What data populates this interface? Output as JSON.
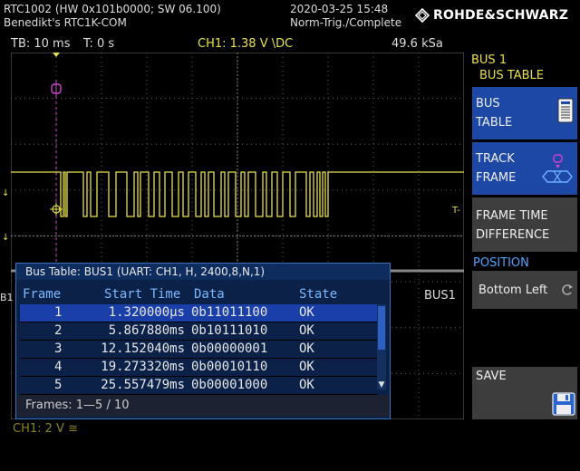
{
  "header": {
    "device_line": "RTC1002 (HW 0x101b0000; SW 06.100)",
    "user_line": "Benedikt's RTC1K-COM",
    "datetime": "2020-03-25 15:48",
    "trigger_status": "Norm-Trig./Complete",
    "brand": "ROHDE&SCHWARZ"
  },
  "status": {
    "timebase": "TB: 10 ms",
    "trigger_time": "T: 0 s",
    "channel": "CH1: 1.38 V \\DC",
    "sample_rate": "49.6 kSa"
  },
  "waveform": {
    "trigger_label": "T",
    "bus_label": "B1",
    "bus_trace_label": "BUS1",
    "marker_right": "T-",
    "ch1_scale": "CH1: 2 V ≅",
    "colors": {
      "trace": "#e8e04a",
      "trigger_marker": "#d040d0",
      "grid": "#5a5a5a"
    }
  },
  "bus_table": {
    "title": "Bus Table: BUS1 (UART: CH1, H, 2400,8,N,1)",
    "columns": [
      "Frame",
      "Start Time",
      "Data",
      "State"
    ],
    "rows": [
      {
        "frame": "1",
        "start": "1.320000µs",
        "data": "0b11011100",
        "state": "OK",
        "selected": true
      },
      {
        "frame": "2",
        "start": "5.867880ms",
        "data": "0b10111010",
        "state": "OK",
        "selected": false
      },
      {
        "frame": "3",
        "start": "12.152040ms",
        "data": "0b00000001",
        "state": "OK",
        "selected": false
      },
      {
        "frame": "4",
        "start": "19.273320ms",
        "data": "0b00010110",
        "state": "OK",
        "selected": false
      },
      {
        "frame": "5",
        "start": "25.557479ms",
        "data": "0b00001000",
        "state": "OK",
        "selected": false
      }
    ],
    "footer": "Frames: 1—5 / 10"
  },
  "menu": {
    "title_line1": "BUS 1",
    "title_line2": "BUS TABLE",
    "softkeys": [
      {
        "line1": "BUS",
        "line2": "TABLE",
        "icon": "table-icon"
      },
      {
        "line1": "TRACK",
        "line2": "FRAME",
        "icon": "track-frame-icon"
      },
      {
        "line1": "FRAME TIME",
        "line2": "DIFFERENCE",
        "icon": ""
      },
      {
        "line1": "Bottom Left",
        "line2": "",
        "icon": "rotate-icon"
      },
      {
        "line1": "SAVE",
        "line2": "",
        "icon": "floppy-icon"
      }
    ],
    "position_label": "POSITION"
  }
}
